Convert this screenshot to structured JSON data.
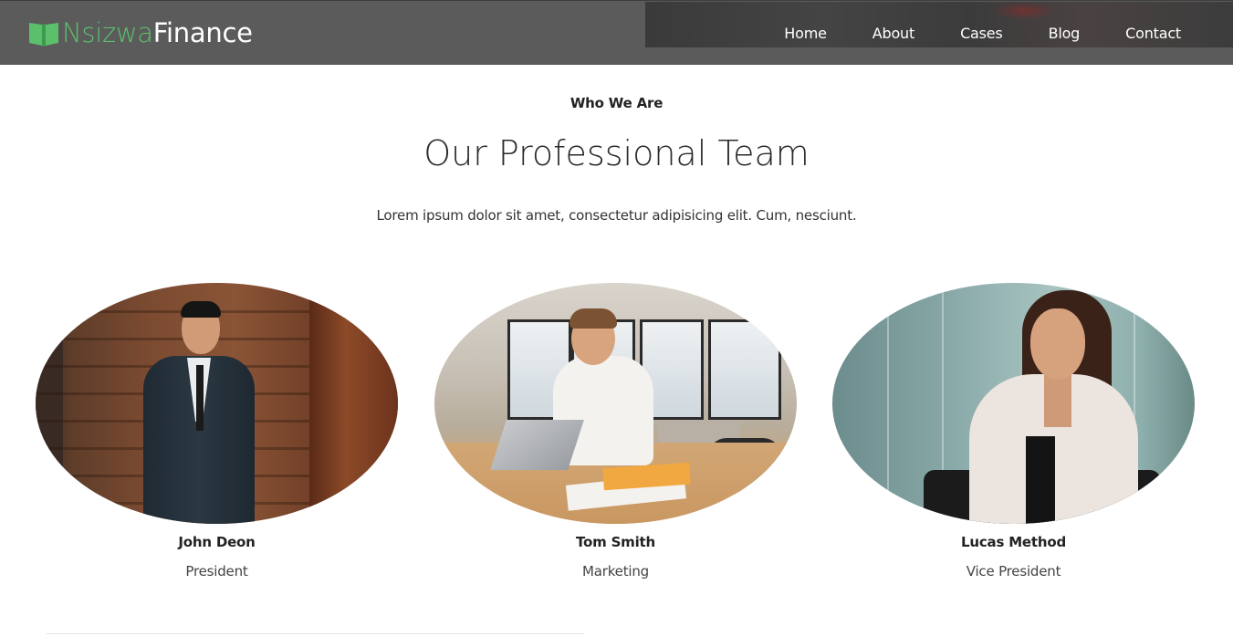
{
  "brand": {
    "name_part1": "Nsizwa",
    "name_part2": "Finance",
    "colors": {
      "accent_green": "#5cbf6c",
      "header_bg": "#5b5b5b",
      "text_dark": "#2b2b2b"
    },
    "icon": "open-book-icon"
  },
  "nav": {
    "items": [
      {
        "label": "Home"
      },
      {
        "label": "About"
      },
      {
        "label": "Cases"
      },
      {
        "label": "Blog"
      },
      {
        "label": "Contact"
      }
    ]
  },
  "section": {
    "eyebrow": "Who We Are",
    "title": "Our Professional Team",
    "subtitle": "Lorem ipsum dolor sit amet, consectetur adipisicing elit. Cum, nesciunt."
  },
  "team": [
    {
      "name": "John Deon",
      "role": "President"
    },
    {
      "name": "Tom Smith",
      "role": "Marketing"
    },
    {
      "name": "Lucas Method",
      "role": "Vice President"
    }
  ]
}
